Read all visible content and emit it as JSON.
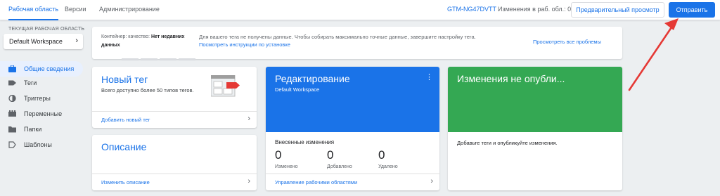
{
  "topbar": {
    "tabs": [
      {
        "label": "Рабочая область",
        "active": true
      },
      {
        "label": "Версии",
        "active": false
      },
      {
        "label": "Администрирование",
        "active": false
      }
    ],
    "container_id": "GTM-NG47DVTT",
    "changes_label": "Изменения в раб. обл.: 0",
    "preview_button": "Предварительный просмотр",
    "submit_button": "Отправить"
  },
  "sidebar": {
    "workspace_caption": "ТЕКУЩАЯ РАБОЧАЯ ОБЛАСТЬ",
    "workspace_name": "Default Workspace",
    "items": [
      {
        "label": "Общие сведения",
        "icon": "briefcase-icon",
        "active": true
      },
      {
        "label": "Теги",
        "icon": "tag-icon",
        "active": false
      },
      {
        "label": "Триггеры",
        "icon": "trigger-icon",
        "active": false
      },
      {
        "label": "Переменные",
        "icon": "variables-icon",
        "active": false
      },
      {
        "label": "Папки",
        "icon": "folder-icon",
        "active": false
      },
      {
        "label": "Шаблоны",
        "icon": "template-icon",
        "active": false
      }
    ]
  },
  "banner": {
    "container_prefix": "Контейнер: качество:",
    "container_quality": "Нет недавних данных",
    "message": "Для вашего тега не получены данные. Чтобы собирать максимально точные данные, завершите настройку тега.",
    "install_link": "Посмотреть инструкции по установке",
    "problems_link": "Просмотреть все проблемы"
  },
  "cards": {
    "new_tag": {
      "title": "Новый тег",
      "description": "Всего доступно более 50 типов тегов.",
      "footer_link": "Добавить новый тег"
    },
    "description": {
      "title": "Описание",
      "footer_link": "Изменить описание"
    },
    "editing": {
      "title": "Редактирование",
      "subtitle": "Default Workspace",
      "changes_label": "Внесенные изменения",
      "stats": [
        {
          "value": "0",
          "label": "Изменено"
        },
        {
          "value": "0",
          "label": "Добавлено"
        },
        {
          "value": "0",
          "label": "Удалено"
        }
      ],
      "footer_link": "Управление рабочими областями",
      "header_color": "#1a73e8"
    },
    "unpublished": {
      "title": "Изменения не опубли...",
      "text": "Добавьте теги и опубликуйте изменения.",
      "header_color": "#34a853"
    }
  },
  "colors": {
    "accent": "#1a73e8",
    "annotation": "#e53935"
  }
}
